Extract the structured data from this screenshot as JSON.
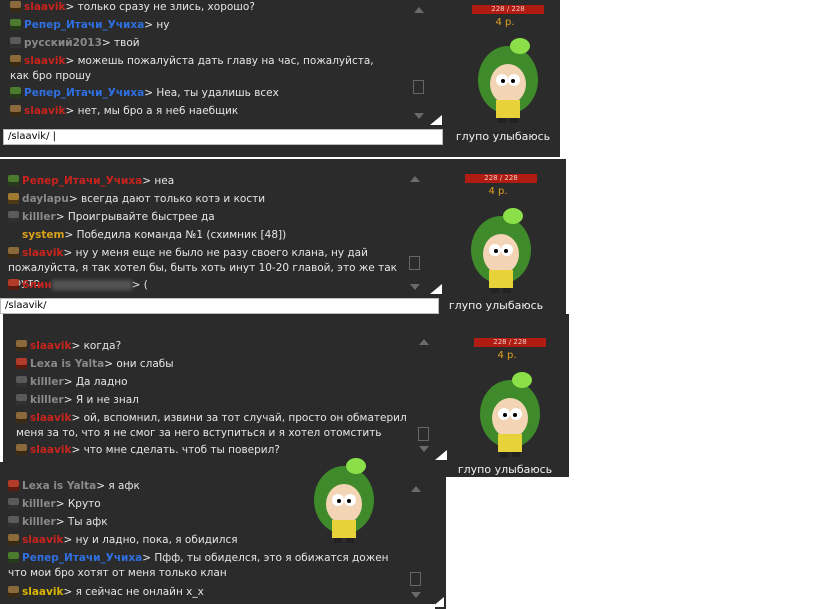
{
  "colors": {
    "panel": "#2b2b2b",
    "name_red": "#c8231d",
    "name_blue": "#2f6fe0",
    "name_gray": "#8a8a8a",
    "system": "#d9a21a",
    "hp_bar": "#b01c12",
    "level": "#e0a020"
  },
  "panel1": {
    "hp": "228 / 228",
    "level": "4 р.",
    "status": "глупо улыбаюсь",
    "input": "/slaavik/ |",
    "messages": [
      {
        "name": "slaavik",
        "text": "> только сразу не злись, хорошо?"
      },
      {
        "name": "Репер_Итачи_Учиха",
        "text": "> ну"
      },
      {
        "name": "русский2013",
        "text": "> твой"
      },
      {
        "name": "slaavik",
        "text": "> можешь пожалуйста дать главу на час, пожалуйста, как бро прошу"
      },
      {
        "name": "Репер_Итачи_Учиха",
        "text": "> Неа, ты удалишь всех"
      },
      {
        "name": "slaavik",
        "text": "> нет, мы бро а я не6 наебщик"
      }
    ]
  },
  "panel2": {
    "hp": "228 / 228",
    "level": "4 р.",
    "status": "глупо улыбаюсь",
    "input": "/slaavik/",
    "messages": [
      {
        "name": "Репер_Итачи_Учиха",
        "text": "> неа"
      },
      {
        "name": "daylapu",
        "text": "> всегда дают только котэ и кости"
      },
      {
        "name": "killler",
        "text": "> Проигрывайте быстрее да"
      },
      {
        "name": "system",
        "text": "> Победила команда №1 (схимник [48])"
      },
      {
        "name": "slaavik",
        "text": "> ну у меня еще не было не разу своего клана, ну дай пожалуйста, я так хотел бы, быть хоть инут 10-20 главой, это же так круто"
      },
      {
        "name": "6лин",
        "text": "> ("
      }
    ]
  },
  "panel3": {
    "hp": "228 / 228",
    "level": "4 р.",
    "status": "глупо улыбаюсь",
    "messages": [
      {
        "name": "slaavik",
        "text": "> когда?"
      },
      {
        "name": "Lexa is Yalta",
        "text": "> они слабы"
      },
      {
        "name": "killler",
        "text": "> Да ладно"
      },
      {
        "name": "killler",
        "text": "> Я и не знал"
      },
      {
        "name": "slaavik",
        "text": "> ой, вспомнил, извини за тот случай, просто он обматерил меня за то, что я не смог за него вступиться и я хотел отомстить"
      },
      {
        "name": "slaavik",
        "text": "> что мне сделать. чтоб ты поверил?"
      }
    ]
  },
  "panel4": {
    "messages": [
      {
        "name": "Lexa is Yalta",
        "text": "> я афк"
      },
      {
        "name": "killler",
        "text": "> Круто"
      },
      {
        "name": "killler",
        "text": "> Ты афк"
      },
      {
        "name": "slaavik",
        "text": "> ну и ладно, пока, я обидился"
      },
      {
        "name": "Репер_Итачи_Учиха",
        "text": "> Пфф, ты обиделся, это я обижатся дожен что мои бро хотят от меня только клан"
      },
      {
        "name": "slaavik",
        "text": "> я сейчас не онлайн х_х"
      }
    ]
  }
}
